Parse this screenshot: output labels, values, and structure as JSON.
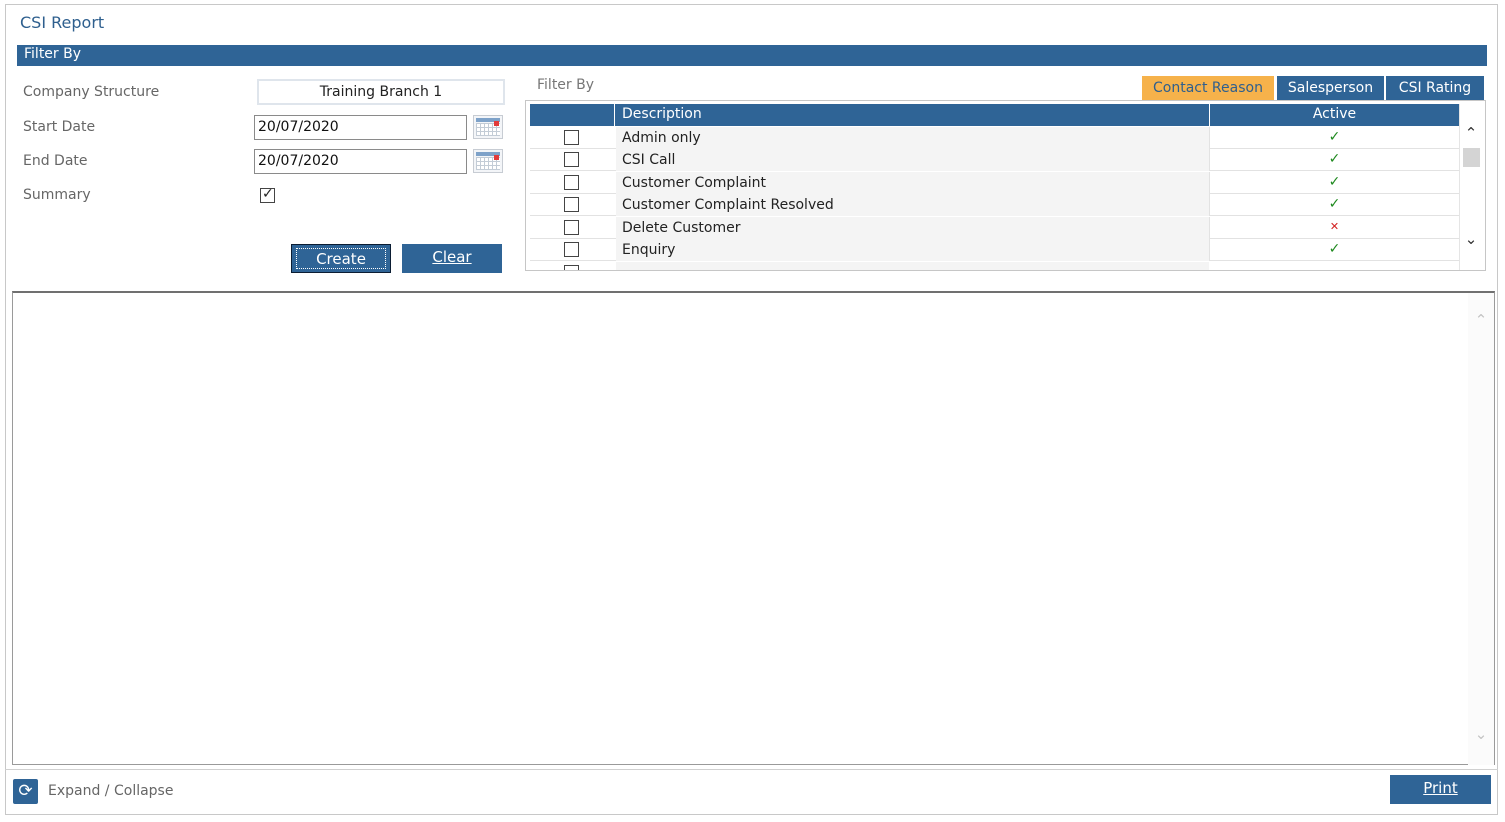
{
  "page": {
    "title": "CSI Report"
  },
  "section": {
    "title": "Filter By"
  },
  "filters": {
    "company_label": "Company Structure",
    "company_value": "Training Branch 1",
    "start_label": "Start Date",
    "start_value": "20/07/2020",
    "end_label": "End Date",
    "end_value": "20/07/2020",
    "summary_label": "Summary",
    "summary_checked": true,
    "summary_tick": "✓",
    "create_label": "Create",
    "clear_label": "Clear"
  },
  "right_panel": {
    "label": "Filter By",
    "tabs": [
      {
        "label": "Contact Reason",
        "active": true
      },
      {
        "label": "Salesperson",
        "active": false
      },
      {
        "label": "CSI Rating",
        "active": false
      }
    ],
    "columns": {
      "description": "Description",
      "active": "Active"
    },
    "rows": [
      {
        "description": "Admin only",
        "active": "✓",
        "is_active": true
      },
      {
        "description": "CSI Call",
        "active": "✓",
        "is_active": true
      },
      {
        "description": "Customer Complaint",
        "active": "✓",
        "is_active": true
      },
      {
        "description": "Customer Complaint Resolved",
        "active": "✓",
        "is_active": true
      },
      {
        "description": "Delete Customer",
        "active": "✕",
        "is_active": false
      },
      {
        "description": "Enquiry",
        "active": "✓",
        "is_active": true
      }
    ],
    "scroll_up_icon": "chevron-up-icon",
    "scroll_down_icon": "chevron-down-icon"
  },
  "footer": {
    "expand_label": "Expand / Collapse",
    "expand_icon": "refresh-icon",
    "print_label": "Print"
  },
  "colors": {
    "primary": "#2f6496",
    "active_tab": "#f6b24b",
    "check_green": "#1f8a1f",
    "cross_red": "#d21f1f"
  }
}
